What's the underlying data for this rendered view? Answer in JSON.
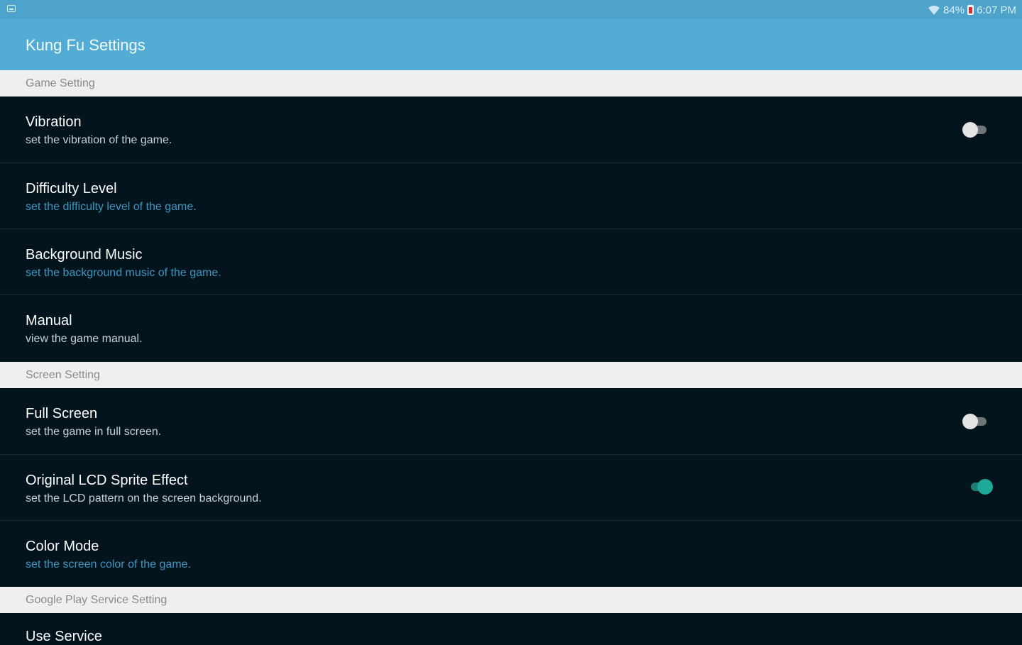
{
  "status_bar": {
    "left_icon": "screenshot-icon",
    "wifi_icon": "wifi-icon",
    "battery_percent": "84%",
    "battery_icon": "battery-low-icon",
    "time": "6:07 PM"
  },
  "action_bar": {
    "title": "Kung Fu Settings"
  },
  "sections": [
    {
      "header": "Game Setting",
      "items": [
        {
          "title": "Vibration",
          "summary": "set the vibration of the game.",
          "toggle": false
        },
        {
          "title": "Difficulty Level",
          "summary": "set the difficulty level of the game."
        },
        {
          "title": "Background Music",
          "summary": "set the background music of the game."
        },
        {
          "title": "Manual",
          "summary": "view the game manual."
        }
      ]
    },
    {
      "header": "Screen Setting",
      "items": [
        {
          "title": "Full Screen",
          "summary": "set the game in full screen.",
          "toggle": false
        },
        {
          "title": "Original LCD Sprite Effect",
          "summary": "set the LCD pattern on the screen background.",
          "toggle": true
        },
        {
          "title": "Color Mode",
          "summary": "set the screen color of the game."
        }
      ]
    },
    {
      "header": "Google Play Service Setting",
      "items": [
        {
          "title": "Use Service"
        }
      ]
    }
  ],
  "colors": {
    "status_bar": "#4da3c9",
    "action_bar": "#53acd4",
    "list_background": "#03141d",
    "section_header_background": "#efefef",
    "summary_accent": "#3b97c2",
    "toggle_on": "#1fa898"
  }
}
